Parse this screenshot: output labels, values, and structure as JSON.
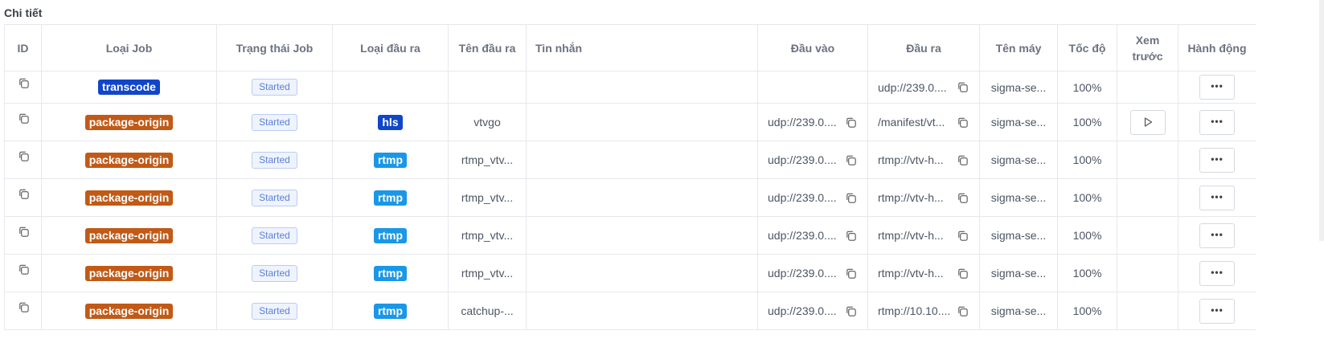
{
  "section_title": "Chi tiết",
  "columns": [
    "ID",
    "Loại Job",
    "Trạng thái Job",
    "Loại đầu ra",
    "Tên đầu ra",
    "Tin nhắn",
    "Đầu vào",
    "Đầu ra",
    "Tên máy",
    "Tốc độ",
    "Xem trước",
    "Hành động"
  ],
  "colors": {
    "transcode": "#1146c9",
    "package_origin": "#c15a17",
    "hls": "#1146c9",
    "rtmp": "#1a97e6",
    "status_border": "#b9cdf4"
  },
  "rows": [
    {
      "job_type": "transcode",
      "job_color": "#1146c9",
      "status": "Started",
      "out_type": "",
      "out_color": "",
      "out_name": "",
      "message": "",
      "input": "",
      "output": "udp://239.0....",
      "machine": "sigma-se...",
      "speed": "100%",
      "preview": false,
      "action": "•••"
    },
    {
      "job_type": "package-origin",
      "job_color": "#c15a17",
      "status": "Started",
      "out_type": "hls",
      "out_color": "#1146c9",
      "out_name": "vtvgo",
      "message": "",
      "input": "udp://239.0....",
      "output": "/manifest/vt...",
      "machine": "sigma-se...",
      "speed": "100%",
      "preview": true,
      "action": "•••"
    },
    {
      "job_type": "package-origin",
      "job_color": "#c15a17",
      "status": "Started",
      "out_type": "rtmp",
      "out_color": "#1a97e6",
      "out_name": "rtmp_vtv...",
      "message": "",
      "input": "udp://239.0....",
      "output": "rtmp://vtv-h...",
      "machine": "sigma-se...",
      "speed": "100%",
      "preview": false,
      "action": "•••"
    },
    {
      "job_type": "package-origin",
      "job_color": "#c15a17",
      "status": "Started",
      "out_type": "rtmp",
      "out_color": "#1a97e6",
      "out_name": "rtmp_vtv...",
      "message": "",
      "input": "udp://239.0....",
      "output": "rtmp://vtv-h...",
      "machine": "sigma-se...",
      "speed": "100%",
      "preview": false,
      "action": "•••"
    },
    {
      "job_type": "package-origin",
      "job_color": "#c15a17",
      "status": "Started",
      "out_type": "rtmp",
      "out_color": "#1a97e6",
      "out_name": "rtmp_vtv...",
      "message": "",
      "input": "udp://239.0....",
      "output": "rtmp://vtv-h...",
      "machine": "sigma-se...",
      "speed": "100%",
      "preview": false,
      "action": "•••"
    },
    {
      "job_type": "package-origin",
      "job_color": "#c15a17",
      "status": "Started",
      "out_type": "rtmp",
      "out_color": "#1a97e6",
      "out_name": "rtmp_vtv...",
      "message": "",
      "input": "udp://239.0....",
      "output": "rtmp://vtv-h...",
      "machine": "sigma-se...",
      "speed": "100%",
      "preview": false,
      "action": "•••"
    },
    {
      "job_type": "package-origin",
      "job_color": "#c15a17",
      "status": "Started",
      "out_type": "rtmp",
      "out_color": "#1a97e6",
      "out_name": "catchup-...",
      "message": "",
      "input": "udp://239.0....",
      "output": "rtmp://10.10....",
      "machine": "sigma-se...",
      "speed": "100%",
      "preview": false,
      "action": "•••"
    }
  ]
}
